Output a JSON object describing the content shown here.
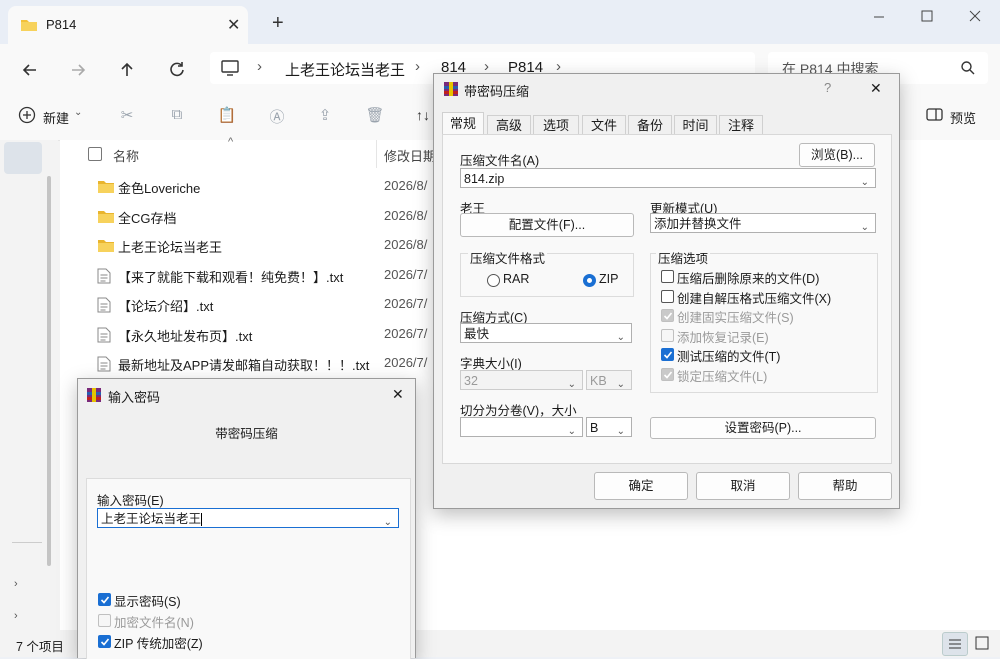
{
  "explorer": {
    "tab_title": "P814",
    "tab_close": "✕",
    "tab_add": "+",
    "breadcrumbs": [
      "上老王论坛当老王",
      "814",
      "P814"
    ],
    "search_placeholder": "在 P814 中搜索",
    "toolbar": {
      "new_label": "新建",
      "sort_label": "↑↓",
      "preview_label": "预览"
    },
    "columns": {
      "name": "名称",
      "modified": "修改日期"
    },
    "files": [
      {
        "name": "金色Loveriche",
        "date": "2026/8/",
        "type": "folder"
      },
      {
        "name": "全CG存档",
        "date": "2026/8/",
        "type": "folder"
      },
      {
        "name": "上老王论坛当老王",
        "date": "2026/8/",
        "type": "folder"
      },
      {
        "name": "【来了就能下载和观看！纯免费！】.txt",
        "date": "2026/7/",
        "type": "file"
      },
      {
        "name": "【论坛介绍】.txt",
        "date": "2026/7/",
        "type": "file"
      },
      {
        "name": "【永久地址发布页】.txt",
        "date": "2026/7/",
        "type": "file"
      },
      {
        "name": "最新地址及APP请发邮箱自动获取！！！.txt",
        "date": "2026/7/",
        "type": "file"
      }
    ],
    "status": "7 个项目"
  },
  "archive_dialog": {
    "title": "带密码压缩",
    "help": "?",
    "close": "✕",
    "tabs": [
      "常规",
      "高级",
      "选项",
      "文件",
      "备份",
      "时间",
      "注释"
    ],
    "archive_name_label": "压缩文件名(A)",
    "browse_button": "浏览(B)...",
    "archive_name_value": "814.zip",
    "profile_label": "老王",
    "profile_button": "配置文件(F)...",
    "update_mode_label": "更新模式(U)",
    "update_mode_value": "添加并替换文件",
    "format_group": "压缩文件格式",
    "format_rar": "RAR",
    "format_zip": "ZIP",
    "options_group": "压缩选项",
    "options": [
      {
        "label": "压缩后删除原来的文件(D)",
        "state": "off"
      },
      {
        "label": "创建自解压格式压缩文件(X)",
        "state": "off"
      },
      {
        "label": "创建固实压缩文件(S)",
        "state": "disabled-checked"
      },
      {
        "label": "添加恢复记录(E)",
        "state": "disabled"
      },
      {
        "label": "测试压缩的文件(T)",
        "state": "on"
      },
      {
        "label": "锁定压缩文件(L)",
        "state": "disabled-checked"
      }
    ],
    "method_label": "压缩方式(C)",
    "method_value": "最快",
    "dict_label": "字典大小(I)",
    "dict_value": "32",
    "dict_unit": "KB",
    "split_label": "切分为分卷(V)，大小",
    "split_value": "",
    "split_unit": "B",
    "set_password_button": "设置密码(P)...",
    "ok_button": "确定",
    "cancel_button": "取消",
    "help_button": "帮助"
  },
  "password_dialog": {
    "title": "输入密码",
    "close": "✕",
    "subtitle": "带密码压缩",
    "password_label": "输入密码(E)",
    "password_value": "上老王论坛当老王",
    "show_password": "显示密码(S)",
    "encrypt_names": "加密文件名(N)",
    "zip_legacy": "ZIP 传统加密(Z)"
  }
}
